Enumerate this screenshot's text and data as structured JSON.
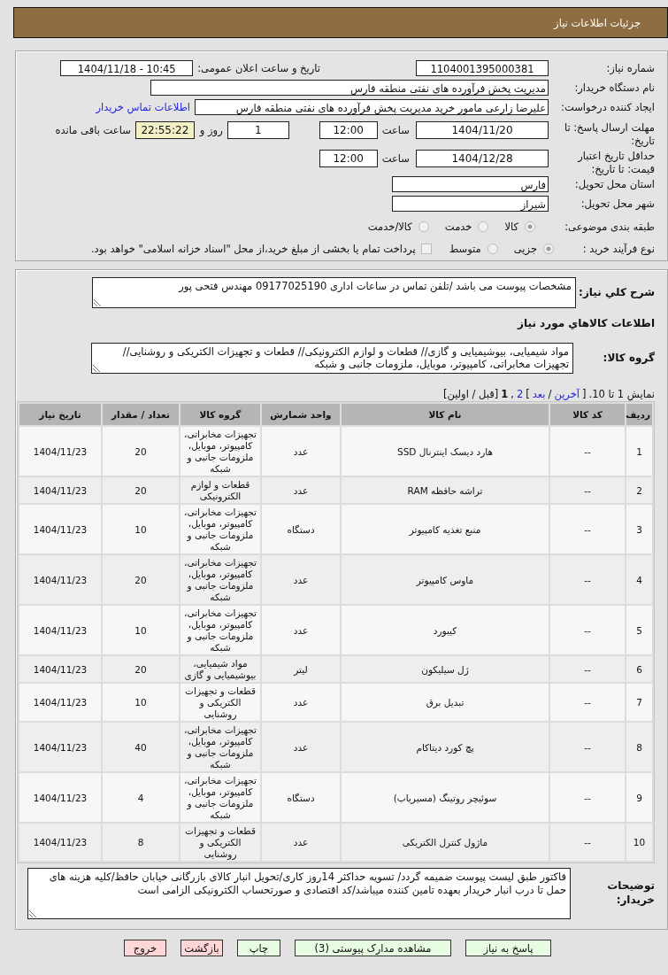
{
  "header": {
    "title": "جزئیات اطلاعات نیاز"
  },
  "details": {
    "need_number": {
      "label": "شماره نیاز:",
      "value": "1104001395000381"
    },
    "announce": {
      "label": "تاریخ و ساعت اعلان عمومی:",
      "value": "1404/11/18 - 10:45"
    },
    "buyer_org": {
      "label": "نام دستگاه خریدار:",
      "value": "مدیریت پخش فرآورده های نفتی منطقه فارس"
    },
    "requester": {
      "label": "ایجاد کننده درخواست:",
      "value": "علیرضا زارعی مامور خرید مدیریت پخش فرآورده های نفتی منطقه فارس",
      "link": "اطلاعات تماس خریدار"
    },
    "reply_deadline": {
      "label": "مهلت ارسال پاسخ: تا تاریخ:",
      "date": "1404/11/20",
      "time_label": "ساعت",
      "time": "12:00",
      "days": "1",
      "days_label": "روز و",
      "remaining": "22:55:22",
      "remaining_label": "ساعت باقی مانده"
    },
    "price_validity": {
      "label": "حداقل تاریخ اعتبار قیمت: تا تاریخ:",
      "date": "1404/12/28",
      "time_label": "ساعت",
      "time": "12:00"
    },
    "province": {
      "label": "استان محل تحویل:",
      "value": "فارس"
    },
    "city": {
      "label": "شهر محل تحویل:",
      "value": "شیراز"
    },
    "classification": {
      "label": "طبقه بندی موضوعی:",
      "options": [
        {
          "label": "کالا",
          "selected": true
        },
        {
          "label": "خدمت",
          "selected": false
        },
        {
          "label": "کالا/خدمت",
          "selected": false
        }
      ]
    },
    "process": {
      "label": "نوع فرآیند خرید :",
      "options": [
        {
          "label": "جزیی",
          "selected": true
        },
        {
          "label": "متوسط",
          "selected": false
        }
      ],
      "treasury": {
        "label": "پرداخت تمام یا بخشی از مبلغ خرید،از محل \"اسناد خزانه اسلامی\" خواهد بود.",
        "checked": false
      }
    }
  },
  "need": {
    "description": {
      "label": "شرح کلي نياز:",
      "value": "مشخصات پیوست می باشد /تلفن تماس در ساعات اداری 09177025190 مهندس فتحی پور"
    },
    "items_heading": "اطلاعات كالاهاي مورد نياز",
    "goods_group": {
      "label": "گروه کالا:",
      "value": "مواد شیمیایی، بیوشیمیایی و گازی// قطعات و لوازم الکترونیکی// قطعات و تجهیزات الکتریکی و روشنایی// تجهیزات مخابراتی، کامپیوتر، موبایل، ملزومات جانبی و شبکه"
    },
    "pagination": {
      "summary": "نمایش 1 تا 10.",
      "parts": [
        {
          "text": "[",
          "kind": "text"
        },
        {
          "text": "آخرین",
          "kind": "link"
        },
        {
          "text": "/",
          "kind": "text"
        },
        {
          "text": "بعد",
          "kind": "link"
        },
        {
          "text": "]",
          "kind": "text"
        },
        {
          "text": "2",
          "kind": "link"
        },
        {
          "text": ",",
          "kind": "text"
        },
        {
          "text": "1",
          "kind": "current"
        },
        {
          "text": "[قبل / اولین]",
          "kind": "text"
        }
      ]
    },
    "items_table": {
      "columns": [
        "ردیف",
        "کد کالا",
        "نام کالا",
        "واحد شمارش",
        "گروه کالا",
        "تعداد / مقدار",
        "تاریخ نیاز"
      ],
      "rows": [
        [
          "1",
          "--",
          "هارد دیسک اینترنال SSD",
          "عدد",
          "تجهیزات مخابراتی، کامپیوتر، موبایل، ملزومات جانبی و شبکه",
          "20",
          "1404/11/23"
        ],
        [
          "2",
          "--",
          "تراشه حافظه RAM",
          "عدد",
          "قطعات و لوازم الکترونیکی",
          "20",
          "1404/11/23"
        ],
        [
          "3",
          "--",
          "منبع تغذیه کامپیوتر",
          "دستگاه",
          "تجهیزات مخابراتی، کامپیوتر، موبایل، ملزومات جانبی و شبکه",
          "10",
          "1404/11/23"
        ],
        [
          "4",
          "--",
          "ماوس کامپیوتر",
          "عدد",
          "تجهیزات مخابراتی، کامپیوتر، موبایل، ملزومات جانبی و شبکه",
          "20",
          "1404/11/23"
        ],
        [
          "5",
          "--",
          "کیبورد",
          "عدد",
          "تجهیزات مخابراتی، کامپیوتر، موبایل، ملزومات جانبی و شبکه",
          "10",
          "1404/11/23"
        ],
        [
          "6",
          "--",
          "ژل سیلیکون",
          "لیتر",
          "مواد شیمیایی، بیوشیمیایی و گازی",
          "20",
          "1404/11/23"
        ],
        [
          "7",
          "--",
          "تبدیل برق",
          "عدد",
          "قطعات و تجهیزات الکتریکی و روشنایی",
          "10",
          "1404/11/23"
        ],
        [
          "8",
          "--",
          "پچ کورد دیتاکام",
          "عدد",
          "تجهیزات مخابراتی، کامپیوتر، موبایل، ملزومات جانبی و شبکه",
          "40",
          "1404/11/23"
        ],
        [
          "9",
          "--",
          "سوئیچر روتینگ (مسیریاب)",
          "دستگاه",
          "تجهیزات مخابراتی، کامپیوتر، موبایل، ملزومات جانبی و شبکه",
          "4",
          "1404/11/23"
        ],
        [
          "10",
          "--",
          "ماژول کنترل الکتریکی",
          "عدد",
          "قطعات و تجهیزات الکتریکی و روشنایی",
          "8",
          "1404/11/23"
        ]
      ]
    },
    "buyer_notes": {
      "label": "توضیحات خریدار:",
      "value": "فاکتور طبق لیست پیوست ضمیمه گردد/ تسویه حداکثر 14روز کاری/تحویل انبار کالای بازرگانی خیابان حافظ/کلیه هزینه های حمل تا درب انبار خریدار بعهده تامین کننده میباشد/کد اقتصادی و صورتحساب الکترونیکی الزامی است"
    }
  },
  "buttons": [
    {
      "label": "پاسخ به نیاز",
      "kind": "action"
    },
    {
      "label": "مشاهده مدارک پیوستی (3)",
      "kind": "action"
    },
    {
      "label": "چاپ",
      "kind": "action"
    },
    {
      "label": "بازگشت",
      "kind": "exit"
    },
    {
      "label": "خروج",
      "kind": "exit"
    }
  ]
}
